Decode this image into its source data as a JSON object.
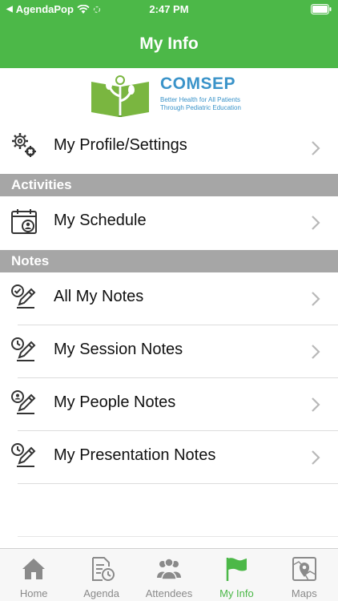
{
  "status_bar": {
    "back_app": "AgendaPop",
    "time": "2:47 PM"
  },
  "header": {
    "title": "My Info"
  },
  "logo": {
    "name": "COMSEP",
    "tagline_line1": "Better Health for All Patients",
    "tagline_line2": "Through Pediatric Education"
  },
  "profile": {
    "label": "My Profile/Settings"
  },
  "activities": {
    "header": "Activities",
    "items": [
      {
        "label": "My Schedule"
      }
    ]
  },
  "notes": {
    "header": "Notes",
    "items": [
      {
        "label": "All My Notes"
      },
      {
        "label": "My Session Notes"
      },
      {
        "label": "My People Notes"
      },
      {
        "label": "My Presentation Notes"
      }
    ]
  },
  "tab_bar": {
    "tabs": [
      {
        "label": "Home"
      },
      {
        "label": "Agenda"
      },
      {
        "label": "Attendees"
      },
      {
        "label": "My Info"
      },
      {
        "label": "Maps"
      }
    ],
    "active_index": 3
  },
  "colors": {
    "brand_green": "#4cb848",
    "section_gray": "#a6a6a6",
    "logo_blue": "#3a93c9"
  }
}
